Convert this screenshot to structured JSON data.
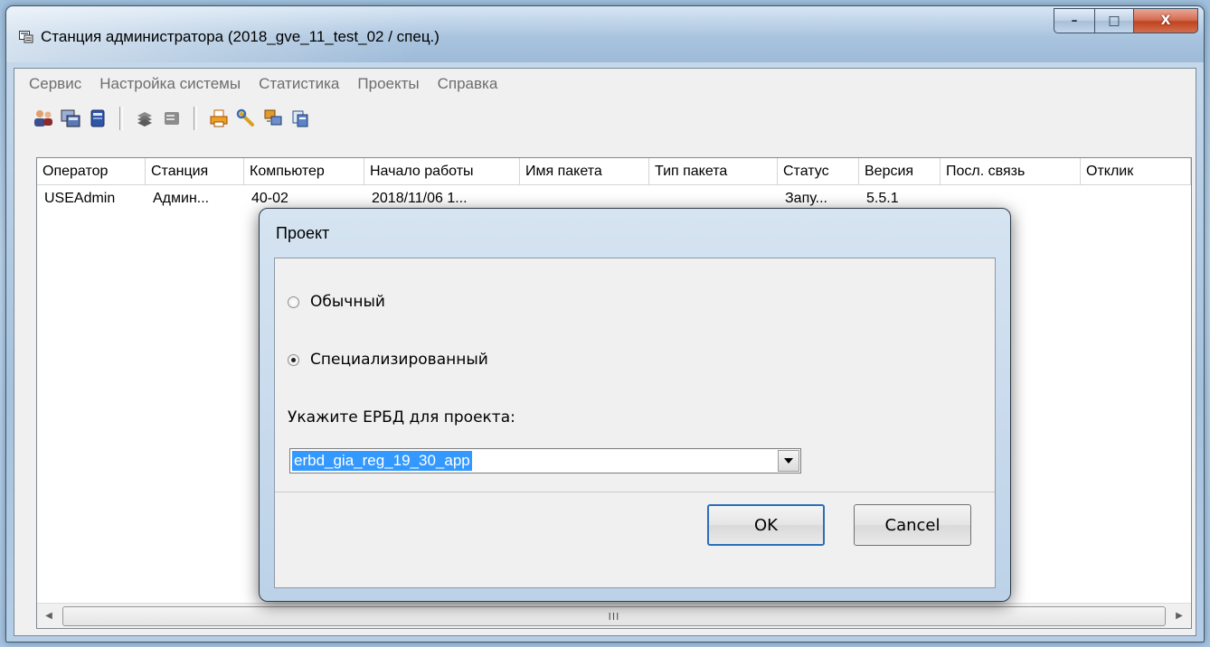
{
  "window": {
    "title": "Станция администратора (2018_gve_11_test_02 / спец.)",
    "buttons": {
      "minimize": "–",
      "maximize": "□",
      "close": "X"
    }
  },
  "menu": {
    "items": [
      "Сервис",
      "Настройка системы",
      "Статистика",
      "Проекты",
      "Справка"
    ]
  },
  "toolbar": {
    "icons": [
      "users-icon",
      "stations-icon",
      "book-icon",
      "stack-icon",
      "document-icon",
      "printer-icon",
      "wrench-icon",
      "network-icon",
      "copy-icon"
    ]
  },
  "table": {
    "columns": [
      "Оператор",
      "Станция",
      "Компьютер",
      "Начало работы",
      "Имя пакета",
      "Тип пакета",
      "Статус",
      "Версия",
      "Посл. связь",
      "Отклик"
    ],
    "rows": [
      [
        "USEAdmin",
        "Админ...",
        "40-02",
        "2018/11/06 1...",
        "",
        "",
        "Запу...",
        "5.5.1",
        "",
        ""
      ]
    ],
    "scroll_thumb_label": "III"
  },
  "dialog": {
    "title": "Проект",
    "radio_normal": "Обычный",
    "radio_special": "Специализированный",
    "selected": "special",
    "ebrd_label": "Укажите ЕРБД для проекта:",
    "ebrd_value": "erbd_gia_reg_19_30_app",
    "ok_label": "OK",
    "cancel_label": "Cancel"
  },
  "colors": {
    "selection": "#3399ff",
    "close_button": "#c04421"
  }
}
